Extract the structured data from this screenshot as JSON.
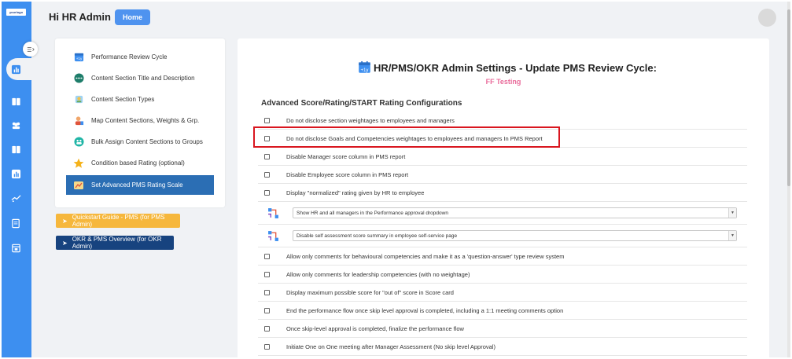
{
  "brand": {
    "logo_text": "yourlogo"
  },
  "header": {
    "greeting": "Hi HR Admin",
    "home_label": "Home"
  },
  "menu": {
    "items": [
      {
        "label": "Performance Review Cycle",
        "icon": "calendar-icon"
      },
      {
        "label": "Content Section Title and Description",
        "icon": "dots-icon"
      },
      {
        "label": "Content Section Types",
        "icon": "types-icon"
      },
      {
        "label": "Map Content Sections, Weights & Grp.",
        "icon": "map-user-icon"
      },
      {
        "label": "Bulk Assign Content Sections to Groups",
        "icon": "group-icon"
      },
      {
        "label": " Condition based Rating (optional)",
        "icon": "star-icon"
      },
      {
        "label": "Set Advanced PMS Rating Scale",
        "icon": "rating-scale-icon",
        "active": true
      }
    ]
  },
  "guides": {
    "quickstart_label": "Quickstart Guide - PMS (for PMS Admin)",
    "okr_label": "OKR & PMS Overview (for OKR Admin)"
  },
  "main": {
    "title": "HR/PMS/OKR Admin Settings - Update PMS Review Cycle:",
    "subtitle": "FF Testing",
    "section_title": "Advanced Score/Rating/START Rating Configurations",
    "options": [
      "Do not disclose section weightages to employees and managers",
      "Do not disclose Goals and Competencies weightages to employees and managers In PMS Report",
      "Disable Manager score column in PMS report",
      "Disable Employee score column in PMS report",
      "Display \"normalized\" rating given by HR to employee"
    ],
    "selects": [
      "Show HR and all managers in the Performance approval dropdown",
      "Disable self assessment score summary in employee self-service page"
    ],
    "options2": [
      "Allow only comments for behavioural competencies and make it as a 'question-answer' type review system",
      "Allow only comments for leadership competencies (with no weightage)",
      "Display maximum possible score for \"out of\" score in Score card",
      "End the performance flow once skip level approval is completed, including a 1:1 meeting comments option",
      "Once skip-level approval is completed, finalize the performance flow",
      "Initiate One on One meeting after Manager Assessment (No skip level Approval)"
    ]
  },
  "colors": {
    "sidebar": "#3d8ff0",
    "active_menu": "#2b6eb4",
    "quickstart": "#f6b73c",
    "okr": "#17437f",
    "subtitle": "#e96b9a",
    "highlight": "#d9161f"
  }
}
